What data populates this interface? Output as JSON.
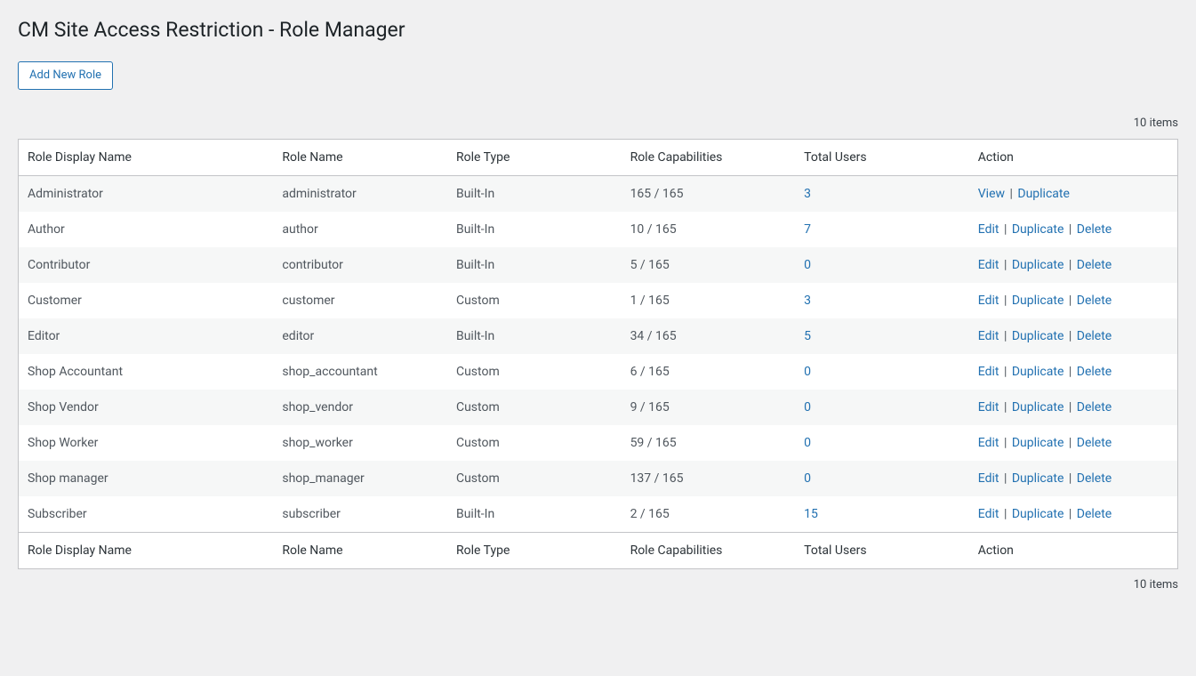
{
  "page": {
    "title": "CM Site Access Restriction - Role Manager",
    "add_button_label": "Add New Role",
    "items_count_top": "10 items",
    "items_count_bottom": "10 items"
  },
  "table": {
    "columns": {
      "display_name": "Role Display Name",
      "role_name": "Role Name",
      "role_type": "Role Type",
      "capabilities": "Role Capabilities",
      "total_users": "Total Users",
      "action": "Action"
    }
  },
  "actions": {
    "view": "View",
    "edit": "Edit",
    "duplicate": "Duplicate",
    "delete": "Delete",
    "sep": " | "
  },
  "roles": [
    {
      "display_name": "Administrator",
      "role_name": "administrator",
      "role_type": "Built-In",
      "capabilities": "165 / 165",
      "total_users": "3",
      "action_set": "view_dup"
    },
    {
      "display_name": "Author",
      "role_name": "author",
      "role_type": "Built-In",
      "capabilities": "10 / 165",
      "total_users": "7",
      "action_set": "edit_dup_del"
    },
    {
      "display_name": "Contributor",
      "role_name": "contributor",
      "role_type": "Built-In",
      "capabilities": "5 / 165",
      "total_users": "0",
      "action_set": "edit_dup_del"
    },
    {
      "display_name": "Customer",
      "role_name": "customer",
      "role_type": "Custom",
      "capabilities": "1 / 165",
      "total_users": "3",
      "action_set": "edit_dup_del"
    },
    {
      "display_name": "Editor",
      "role_name": "editor",
      "role_type": "Built-In",
      "capabilities": "34 / 165",
      "total_users": "5",
      "action_set": "edit_dup_del"
    },
    {
      "display_name": "Shop Accountant",
      "role_name": "shop_accountant",
      "role_type": "Custom",
      "capabilities": "6 / 165",
      "total_users": "0",
      "action_set": "edit_dup_del"
    },
    {
      "display_name": "Shop Vendor",
      "role_name": "shop_vendor",
      "role_type": "Custom",
      "capabilities": "9 / 165",
      "total_users": "0",
      "action_set": "edit_dup_del"
    },
    {
      "display_name": "Shop Worker",
      "role_name": "shop_worker",
      "role_type": "Custom",
      "capabilities": "59 / 165",
      "total_users": "0",
      "action_set": "edit_dup_del"
    },
    {
      "display_name": "Shop manager",
      "role_name": "shop_manager",
      "role_type": "Custom",
      "capabilities": "137 / 165",
      "total_users": "0",
      "action_set": "edit_dup_del"
    },
    {
      "display_name": "Subscriber",
      "role_name": "subscriber",
      "role_type": "Built-In",
      "capabilities": "2 / 165",
      "total_users": "15",
      "action_set": "edit_dup_del"
    }
  ]
}
